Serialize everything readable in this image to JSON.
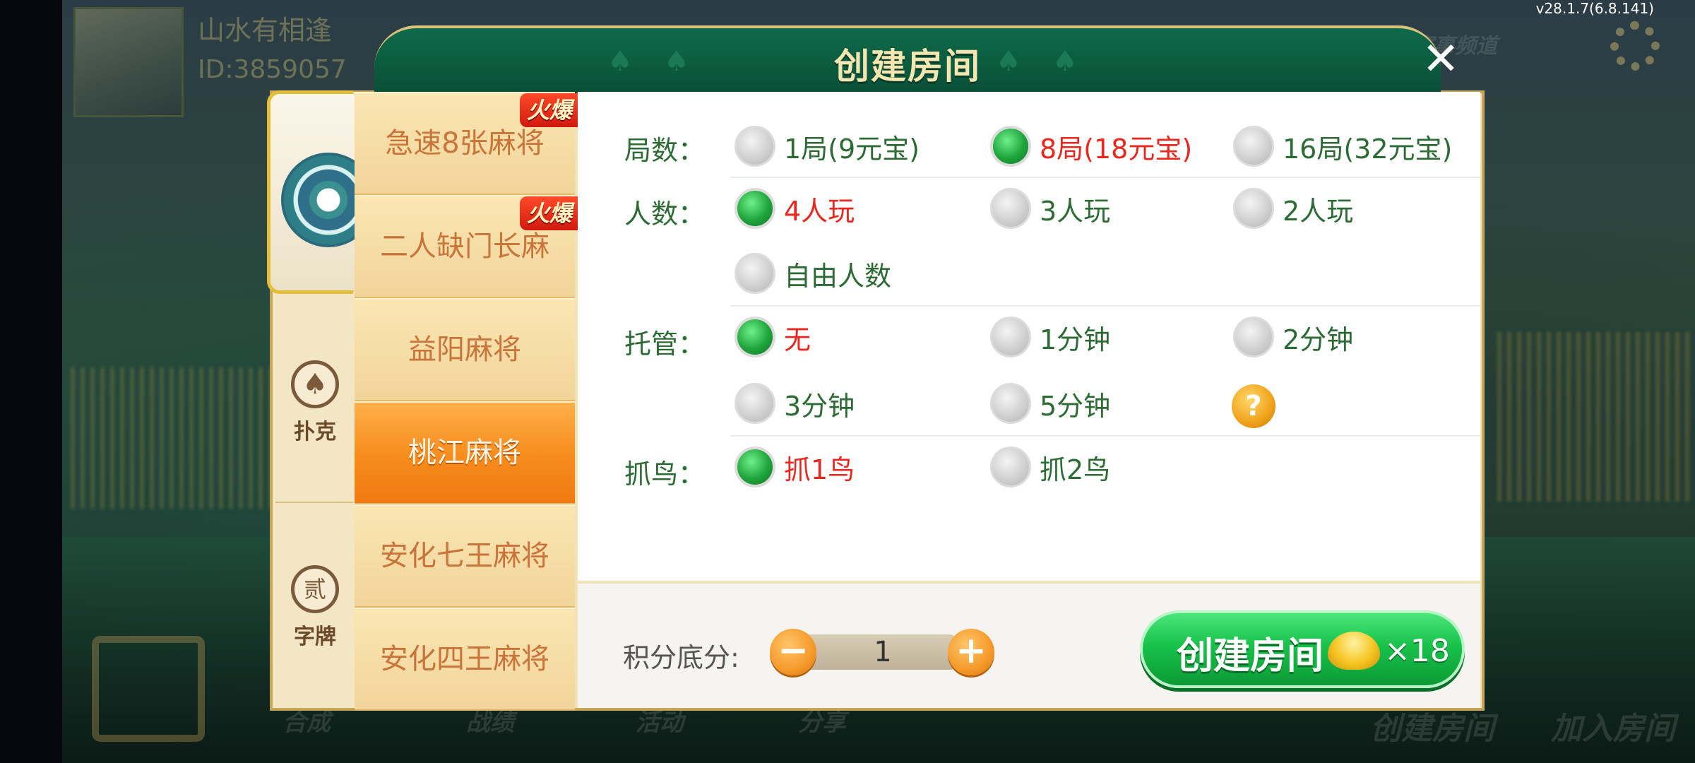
{
  "version": "v28.1.7(6.8.141)",
  "background": {
    "player_name": "山水有相逢",
    "player_id": "ID:3859057",
    "bottom_left_ghost": "合成",
    "bottom_ghost_2": "战绩",
    "bottom_ghost_3": "活动",
    "bottom_ghost_4": "分享",
    "bottom_create": "创建房间",
    "bottom_join": "加入房间",
    "top_right_ghost": "赛事频道"
  },
  "dialog": {
    "title": "创建房间",
    "close_symbol": "✕"
  },
  "categories": [
    {
      "name": "mahjong",
      "icon": "mahjong-tile-icon"
    },
    {
      "name": "poker",
      "label": "扑克",
      "icon": "spade-icon",
      "glyph": "♠"
    },
    {
      "name": "zipai",
      "label": "字牌",
      "icon": "er-tile-icon",
      "glyph": "贰"
    }
  ],
  "games": [
    {
      "label": "急速8张麻将",
      "hot": "火爆",
      "active": false
    },
    {
      "label": "二人缺门长麻",
      "hot": "火爆",
      "active": false
    },
    {
      "label": "益阳麻将",
      "active": false
    },
    {
      "label": "桃江麻将",
      "active": true
    },
    {
      "label": "安化七王麻将",
      "active": false
    },
    {
      "label": "安化四王麻将",
      "active": false
    }
  ],
  "options": {
    "rounds": {
      "label": "局数：",
      "items": [
        {
          "text": "1局(9元宝)",
          "selected": false
        },
        {
          "text": "8局(18元宝)",
          "selected": true
        },
        {
          "text": "16局(32元宝)",
          "selected": false
        }
      ]
    },
    "players": {
      "label": "人数：",
      "items": [
        {
          "text": "4人玩",
          "selected": true
        },
        {
          "text": "3人玩",
          "selected": false
        },
        {
          "text": "2人玩",
          "selected": false
        },
        {
          "text": "自由人数",
          "selected": false
        }
      ]
    },
    "autoplay": {
      "label": "托管：",
      "items": [
        {
          "text": "无",
          "selected": true
        },
        {
          "text": "1分钟",
          "selected": false
        },
        {
          "text": "2分钟",
          "selected": false
        },
        {
          "text": "3分钟",
          "selected": false
        },
        {
          "text": "5分钟",
          "selected": false
        }
      ],
      "help": "?"
    },
    "birds": {
      "label": "抓鸟：",
      "items": [
        {
          "text": "抓1鸟",
          "selected": true
        },
        {
          "text": "抓2鸟",
          "selected": false
        }
      ]
    }
  },
  "footer": {
    "score_label": "积分底分:",
    "score_value": "1",
    "minus": "−",
    "plus": "+",
    "create_label": "创建房间",
    "create_cost": "×18"
  },
  "colors": {
    "selected_text": "#e8271e",
    "normal_text": "#2d6b35",
    "active_tab": "#f78b1c",
    "create_button": "#18c24a"
  }
}
